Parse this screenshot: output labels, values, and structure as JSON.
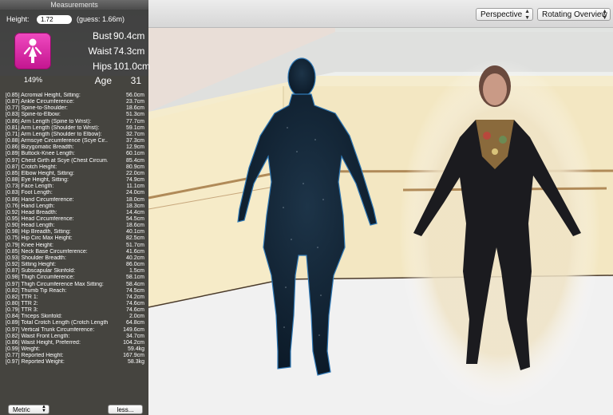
{
  "panel": {
    "title": "Measurements",
    "height_label": "Height:",
    "height_value": "1.72",
    "height_guess": "(guess: 1.66m)",
    "percent": "149%",
    "stats": [
      {
        "label": "Bust",
        "value": "90.4cm"
      },
      {
        "label": "Waist",
        "value": "74.3cm"
      },
      {
        "label": "Hips",
        "value": "101.0cm"
      },
      {
        "label": "Age",
        "value": "31"
      }
    ],
    "measurements": [
      {
        "name": "[0.85] Acromial Height, Sitting:",
        "value": "56.0cm"
      },
      {
        "name": "[0.87] Ankle Circumference:",
        "value": "23.7cm"
      },
      {
        "name": "[0.77] Spine-to-Shoulder:",
        "value": "18.6cm"
      },
      {
        "name": "[0.83] Spine-to-Elbow:",
        "value": "51.3cm"
      },
      {
        "name": "[0.86] Arm Length (Spine to Wrist):",
        "value": "77.7cm"
      },
      {
        "name": "[0.81] Arm Length (Shoulder to Wrist):",
        "value": "59.1cm"
      },
      {
        "name": "[0.71] Arm Length (Shoulder to Elbow):",
        "value": "32.7cm"
      },
      {
        "name": "[0.88] Armscye Circumference (Scye Cir...",
        "value": "37.3cm"
      },
      {
        "name": "[0.86] Bizygomatic Breadth:",
        "value": "12.9cm"
      },
      {
        "name": "[0.89] Buttock-Knee Length:",
        "value": "60.1cm"
      },
      {
        "name": "[0.97] Chest Girth at Scye (Chest Circum...",
        "value": "85.4cm"
      },
      {
        "name": "[0.87] Crotch Height:",
        "value": "80.9cm"
      },
      {
        "name": "[0.85] Elbow Height, Sitting:",
        "value": "22.0cm"
      },
      {
        "name": "[0.88] Eye Height, Sitting:",
        "value": "74.9cm"
      },
      {
        "name": "[0.73] Face Length:",
        "value": "11.1cm"
      },
      {
        "name": "[0.83] Foot Length:",
        "value": "24.0cm"
      },
      {
        "name": "[0.86] Hand Circumference:",
        "value": "18.0cm"
      },
      {
        "name": "[0.76] Hand Length:",
        "value": "18.3cm"
      },
      {
        "name": "[0.92] Head Breadth:",
        "value": "14.4cm"
      },
      {
        "name": "[0.95] Head Circumference:",
        "value": "54.5cm"
      },
      {
        "name": "[0.90] Head Length:",
        "value": "18.6cm"
      },
      {
        "name": "[0.98] Hip Breadth, Sitting:",
        "value": "40.1cm"
      },
      {
        "name": "[0.75] Hip Circ Max Height:",
        "value": "82.5cm"
      },
      {
        "name": "[0.79] Knee Height:",
        "value": "51.7cm"
      },
      {
        "name": "[0.85] Neck Base Circumference:",
        "value": "41.6cm"
      },
      {
        "name": "[0.93] Shoulder Breadth:",
        "value": "40.2cm"
      },
      {
        "name": "[0.92] Sitting Height:",
        "value": "86.0cm"
      },
      {
        "name": "[0.87] Subscapular Skinfold:",
        "value": "1.5cm"
      },
      {
        "name": "[0.98] Thigh Circumference:",
        "value": "58.1cm"
      },
      {
        "name": "[0.97] Thigh Circumference Max Sitting:",
        "value": "58.4cm"
      },
      {
        "name": "[0.82] Thumb Tip Reach:",
        "value": "74.5cm"
      },
      {
        "name": "[0.82] TTR 1:",
        "value": "74.2cm"
      },
      {
        "name": "[0.80] TTR 2:",
        "value": "74.6cm"
      },
      {
        "name": "[0.79] TTR 3:",
        "value": "74.6cm"
      },
      {
        "name": "[0.84] Triceps Skinfold:",
        "value": "2.0cm"
      },
      {
        "name": "[0.89] Total Crotch Length (Crotch Length):",
        "value": "64.8cm"
      },
      {
        "name": "[0.97] Vertical Trunk Circumference:",
        "value": "149.6cm"
      },
      {
        "name": "[0.82] Waist Front Length:",
        "value": "34.7cm"
      },
      {
        "name": "[0.86] Waist Height, Preferred:",
        "value": "104.2cm"
      },
      {
        "name": "[0.99] Weight:",
        "value": "59.4kg"
      },
      {
        "name": "[0.77] Reported Height:",
        "value": "167.9cm"
      },
      {
        "name": "[0.97] Reported Weight:",
        "value": "58.3kg"
      }
    ],
    "unit_select": "Metric",
    "less_button": "less..."
  },
  "toolbar": {
    "projection_select": "Perspective",
    "view_select": "Rotating Overview"
  },
  "colors": {
    "avatar_icon": "#e02fae",
    "mesh": "#13283a",
    "mesh_glow": "#2f78b5",
    "wall": "#f3e7c2",
    "barre": "#b08a58"
  },
  "icons": {
    "avatar": "female-figure-icon"
  }
}
